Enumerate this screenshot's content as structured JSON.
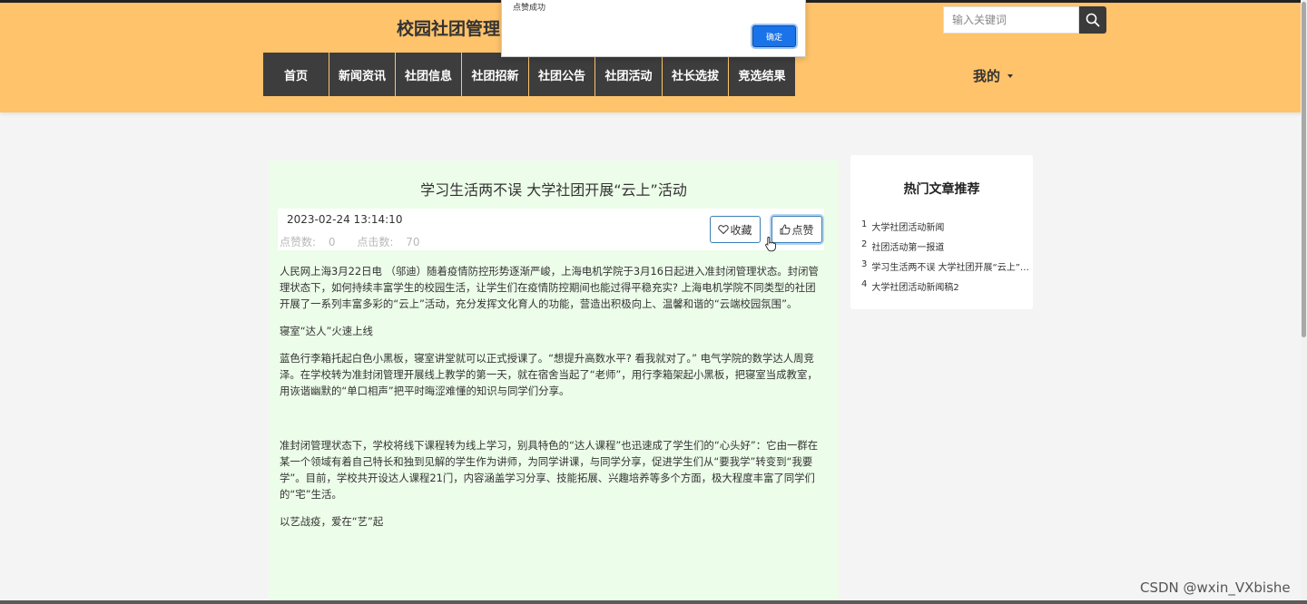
{
  "site": {
    "title": "校园社团管理"
  },
  "nav": [
    {
      "label": "首页"
    },
    {
      "label": "新闻资讯"
    },
    {
      "label": "社团信息"
    },
    {
      "label": "社团招新"
    },
    {
      "label": "社团公告"
    },
    {
      "label": "社团活动"
    },
    {
      "label": "社长选拔"
    },
    {
      "label": "竞选结果"
    }
  ],
  "search": {
    "placeholder": "输入关键词",
    "icon": "search-icon"
  },
  "user_menu": {
    "label": "我的",
    "icon": "caret-down-icon"
  },
  "alert": {
    "message": "点赞成功",
    "ok_label": "确定"
  },
  "article": {
    "title": "学习生活两不误 大学社团开展“云上”活动",
    "date": "2023-02-24 13:14:10",
    "likes_label": "点赞数:",
    "likes": "0",
    "clicks_label": "点击数:",
    "clicks": "70",
    "favorite_label": "收藏",
    "like_label": "点赞",
    "paragraphs": [
      "人民网上海3月22日电 （邬迪）随着疫情防控形势逐渐严峻，上海电机学院于3月16日起进入准封闭管理状态。封闭管理状态下，如何持续丰富学生的校园生活，让学生们在疫情防控期间也能过得平稳充实? 上海电机学院不同类型的社团开展了一系列丰富多彩的“云上”活动，充分发挥文化育人的功能，营造出积极向上、温馨和谐的“云端校园氛围”。",
      "寝室“达人”火速上线",
      "蓝色行李箱托起白色小黑板，寝室讲堂就可以正式授课了。“想提升高数水平? 看我就对了。” 电气学院的数学达人周竞泽。在学校转为准封闭管理开展线上教学的第一天，就在宿舍当起了“老师”，用行李箱架起小黑板，把寝室当成教室，用诙谐幽默的“单口相声”把平时晦涩难懂的知识与同学们分享。",
      "准封闭管理状态下，学校将线下课程转为线上学习，别具特色的“达人课程”也迅速成了学生们的“心头好”：它由一群在某一个领域有着自己特长和独到见解的学生作为讲师，为同学讲课，与同学分享，促进学生们从“要我学”转变到“我要学”。目前，学校共开设达人课程21门，内容涵盖学习分享、技能拓展、兴趣培养等多个方面，极大程度丰富了同学们的“宅”生活。",
      "以艺战疫，爱在“艺”起"
    ]
  },
  "sidebar": {
    "title": "热门文章推荐",
    "items": [
      {
        "num": "1",
        "text": "大学社团活动新闻"
      },
      {
        "num": "2",
        "text": "社团活动第一报道"
      },
      {
        "num": "3",
        "text": "学习生活两不误 大学社团开展“云上”活动"
      },
      {
        "num": "4",
        "text": "大学社团活动新闻稿2"
      }
    ]
  },
  "watermark": "CSDN @wxin_VXbishe"
}
